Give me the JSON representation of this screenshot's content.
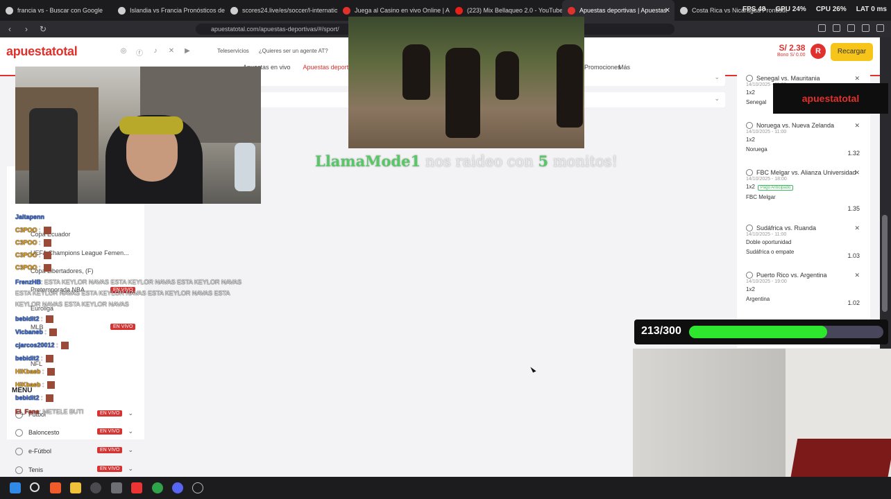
{
  "browser": {
    "tabs": [
      {
        "title": "francia vs - Buscar con Google"
      },
      {
        "title": "Islandia vs Francia Pronósticos de Fú"
      },
      {
        "title": "scores24.live/es/soccer/l-internatio"
      },
      {
        "title": "Juega al Casino en vivo Online | Apu"
      },
      {
        "title": "(223) Mix Bellaqueo 2.0 - YouTube"
      },
      {
        "title": "Apuestas deportivas | Apuestas",
        "active": true
      },
      {
        "title": "Costa Rica vs Nicaragua Pronóstico"
      }
    ],
    "stats": [
      "FPS 48",
      "GPU 24%",
      "CPU 26%",
      "LAT 0 ms"
    ],
    "url": "apuestatotal.com/apuestas-deportivas/#/sport/"
  },
  "site": {
    "logo": "apuestatotal",
    "top_links": [
      "Teleservicios",
      "¿Quieres ser un agente AT?"
    ],
    "nav": [
      "Apuestas en vivo",
      "Apuestas deportivas"
    ],
    "nav_promos": "Promociones",
    "nav_more": "Más",
    "balance": "S/ 2.38",
    "bono": "Bono S/ 0.00",
    "avatar_letter": "R",
    "recargar": "Recargar",
    "menu_label": "MENU",
    "sports": [
      {
        "name": "Fútbol",
        "vivo": "EN VIVO"
      },
      {
        "name": "Baloncesto",
        "vivo": "EN VIVO"
      },
      {
        "name": "e-Fútbol",
        "vivo": "EN VIVO"
      },
      {
        "name": "Tenis",
        "vivo": "EN VIVO"
      }
    ],
    "competitions": [
      "Copa Ecuador",
      "UEFA Champions League Femen...",
      "Copa Libertadores, (F)",
      "Pretemporada NBA",
      "Euroliga",
      "MLB",
      "NFL"
    ],
    "live_badge": "EN VIVO"
  },
  "betslip": [
    {
      "match": "Senegal vs. Mauritania",
      "date": "14/10/2025 - 11:00",
      "market": "1x2",
      "pick": "Senegal",
      "odd": ""
    },
    {
      "match": "Noruega vs. Nueva Zelanda",
      "date": "14/10/2025 - 11:00",
      "market": "1x2",
      "pick": "Noruega",
      "odd": "1.32"
    },
    {
      "match": "FBC Melgar vs. Alianza Universidad",
      "date": "14/10/2025 - 18:00",
      "market": "1x2",
      "badge": "Pago Anticipado",
      "pick": "FBC Melgar",
      "odd": "1.35"
    },
    {
      "match": "Sudáfrica vs. Ruanda",
      "date": "14/10/2025 - 11:00",
      "market": "Doble oportunidad",
      "pick": "Sudáfrica o empate",
      "odd": "1.03"
    },
    {
      "match": "Puerto Rico vs. Argentina",
      "date": "14/10/2025 - 19:00",
      "market": "1x2",
      "pick": "Argentina",
      "odd": "1.02"
    }
  ],
  "stream": {
    "raid_user": "LlamaMode1",
    "raid_text": "nos raideo con",
    "raid_count": "5",
    "raid_suffix": "monitos!",
    "logo_overlay": "apuestatotal",
    "goal_text": "213/300",
    "goal_fraction": 0.71
  },
  "chat": [
    {
      "user": "Jaitapenn",
      "msg": ""
    },
    {
      "user": "C3POO",
      "msg": ":"
    },
    {
      "user": "C3POO",
      "msg": ":"
    },
    {
      "user": "C3POO",
      "msg": ":"
    },
    {
      "user": "C3POO",
      "msg": ":"
    },
    {
      "user": "FrenzHB",
      "msg": ": ESTA KEYLOR NAVAS ESTA KEYLOR NAVAS ESTA KEYLOR NAVAS"
    },
    {
      "user": "",
      "msg": "ESTA KEYLOR NAVAS ESTA KEYLOR NAVAS ESTA KEYLOR NAVAS ESTA"
    },
    {
      "user": "",
      "msg": "KEYLOR NAVAS ESTA KEYLOR NAVAS"
    },
    {
      "user": "bebidit2",
      "msg": ":"
    },
    {
      "user": "Vicbaneb",
      "msg": ":"
    },
    {
      "user": "cjarcos20012",
      "msg": ":"
    },
    {
      "user": "bebidit2",
      "msg": ":"
    },
    {
      "user": "HiKbaeb",
      "msg": ":"
    },
    {
      "user": "HiKbaeb",
      "msg": ":"
    },
    {
      "user": "bebidit2",
      "msg": ":"
    },
    {
      "user": "El_Fane",
      "msg": ": METELE BUTI"
    }
  ]
}
